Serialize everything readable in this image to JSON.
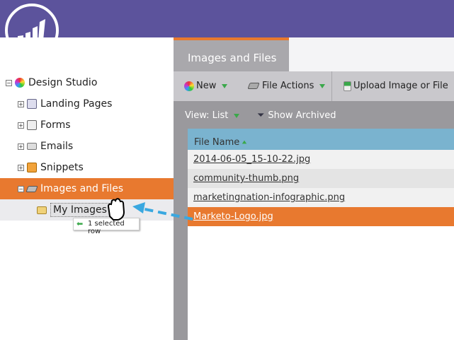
{
  "tree": {
    "root": "Design Studio",
    "items": [
      {
        "label": "Landing Pages"
      },
      {
        "label": "Forms"
      },
      {
        "label": "Emails"
      },
      {
        "label": "Snippets"
      },
      {
        "label": "Images and Files"
      }
    ],
    "sub": "My Images"
  },
  "tab": "Images and Files",
  "toolbar": {
    "new": "New",
    "file_actions": "File Actions",
    "upload": "Upload Image or File"
  },
  "viewbar": {
    "view": "View: List",
    "archived": "Show Archived"
  },
  "grid": {
    "header": "File Name",
    "rows": [
      "2014-06-05_15-10-22.jpg",
      "community-thumb.png",
      "marketingnation-infographic.png",
      "Marketo-Logo.jpg"
    ]
  },
  "tooltip": "1 selected row",
  "colors": {
    "purple": "#5c539c",
    "orange": "#e8792f",
    "grid_header": "#7ab3cf"
  }
}
